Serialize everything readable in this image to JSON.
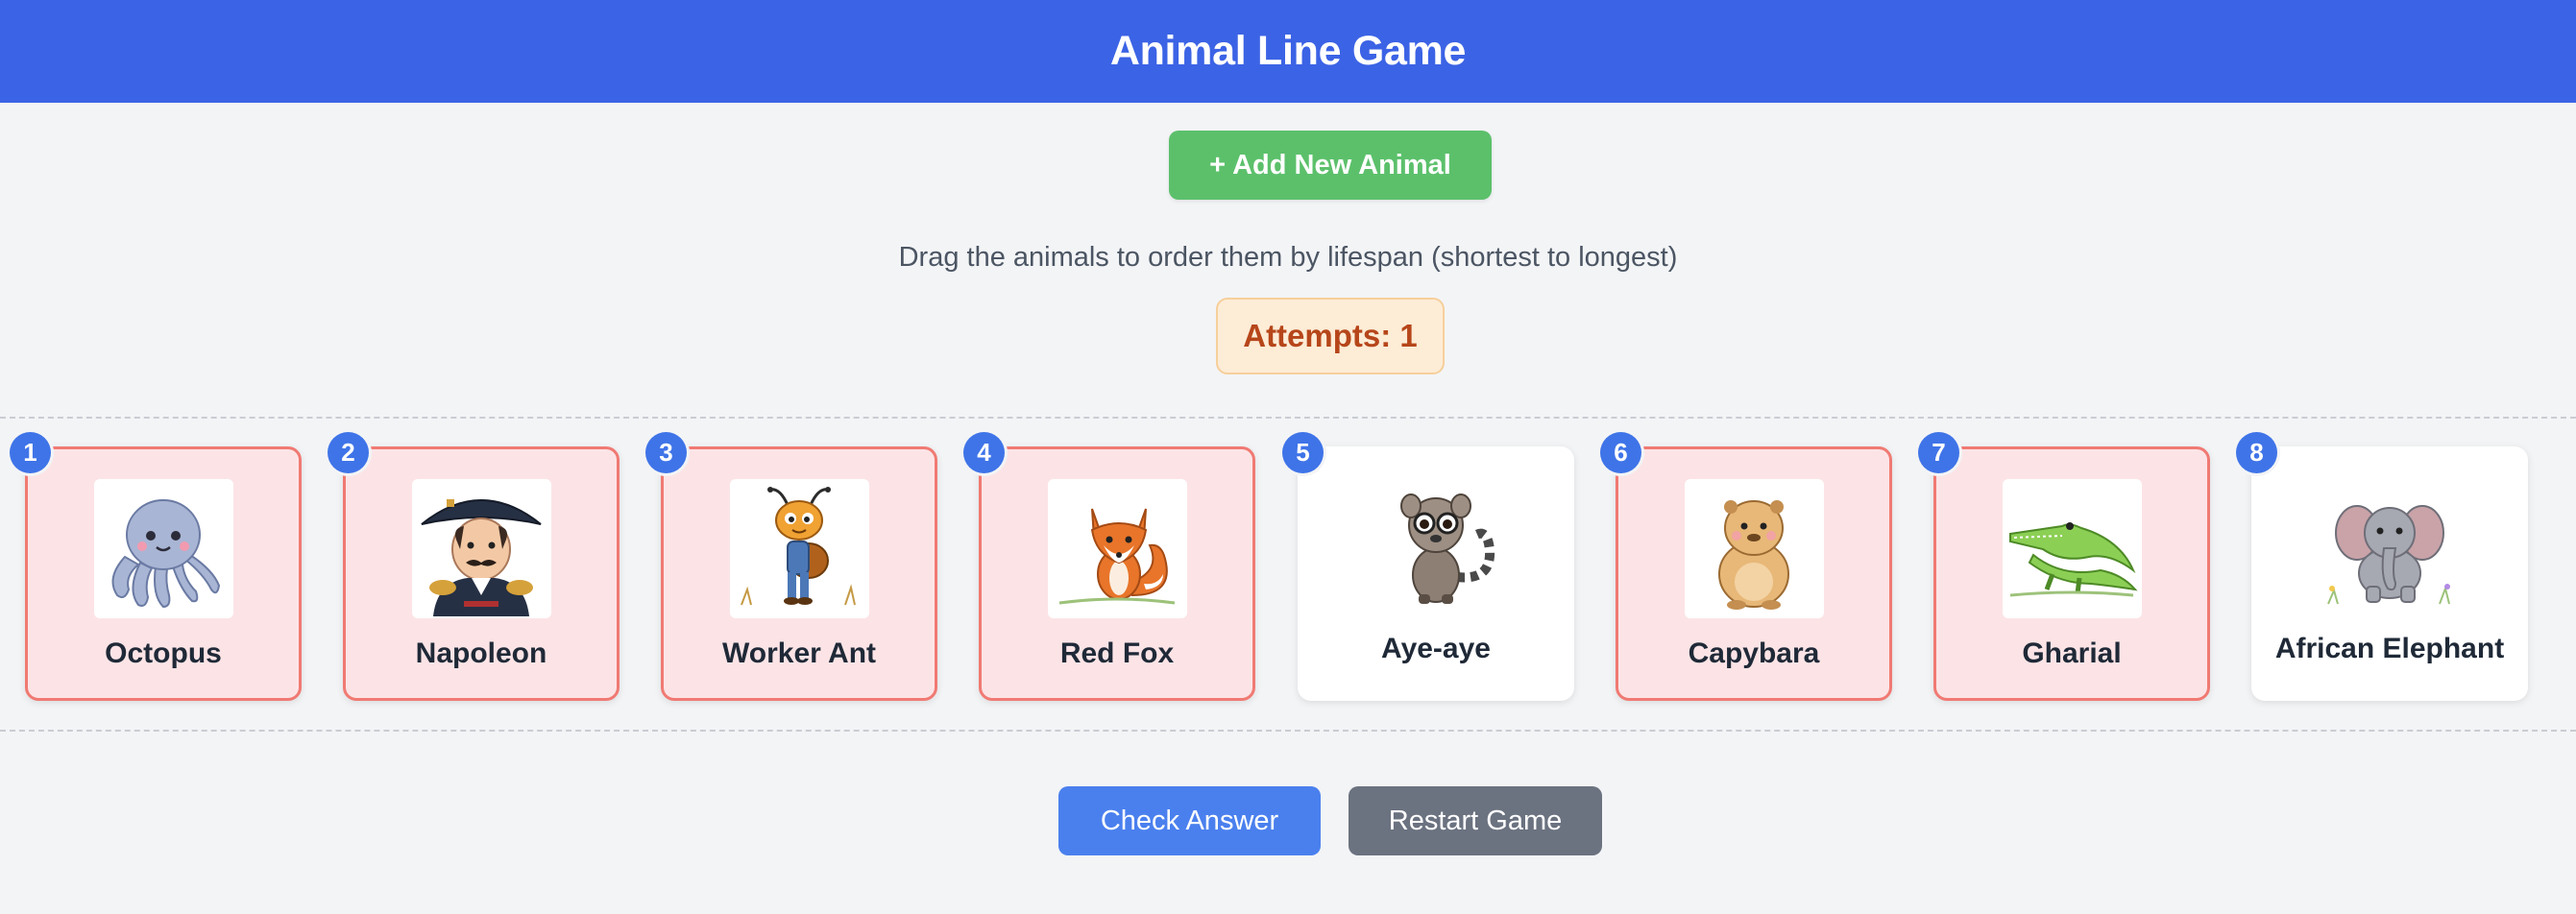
{
  "header": {
    "title": "Animal Line Game"
  },
  "actions": {
    "add_label": "+ Add New Animal",
    "check_label": "Check Answer",
    "restart_label": "Restart Game"
  },
  "instructions": "Drag the animals to order them by lifespan (shortest to longest)",
  "attempts": {
    "text": "Attempts: 1"
  },
  "cards": [
    {
      "position": "1",
      "name": "Octopus",
      "icon": "octopus-icon",
      "state": "wrong"
    },
    {
      "position": "2",
      "name": "Napoleon",
      "icon": "napoleon-icon",
      "state": "wrong"
    },
    {
      "position": "3",
      "name": "Worker Ant",
      "icon": "ant-icon",
      "state": "wrong"
    },
    {
      "position": "4",
      "name": "Red Fox",
      "icon": "fox-icon",
      "state": "wrong"
    },
    {
      "position": "5",
      "name": "Aye-aye",
      "icon": "aye-aye-icon",
      "state": "correct"
    },
    {
      "position": "6",
      "name": "Capybara",
      "icon": "capybara-icon",
      "state": "wrong"
    },
    {
      "position": "7",
      "name": "Gharial",
      "icon": "gharial-icon",
      "state": "wrong"
    },
    {
      "position": "8",
      "name": "African Elephant",
      "icon": "elephant-icon",
      "state": "correct"
    }
  ],
  "colors": {
    "header": "#3b63e5",
    "add_button": "#5cc06b",
    "check_button": "#4a80ee",
    "restart_button": "#6b7280",
    "wrong_card_bg": "#fce4e6",
    "wrong_card_border": "#f07a73",
    "badge": "#3f74e8"
  }
}
